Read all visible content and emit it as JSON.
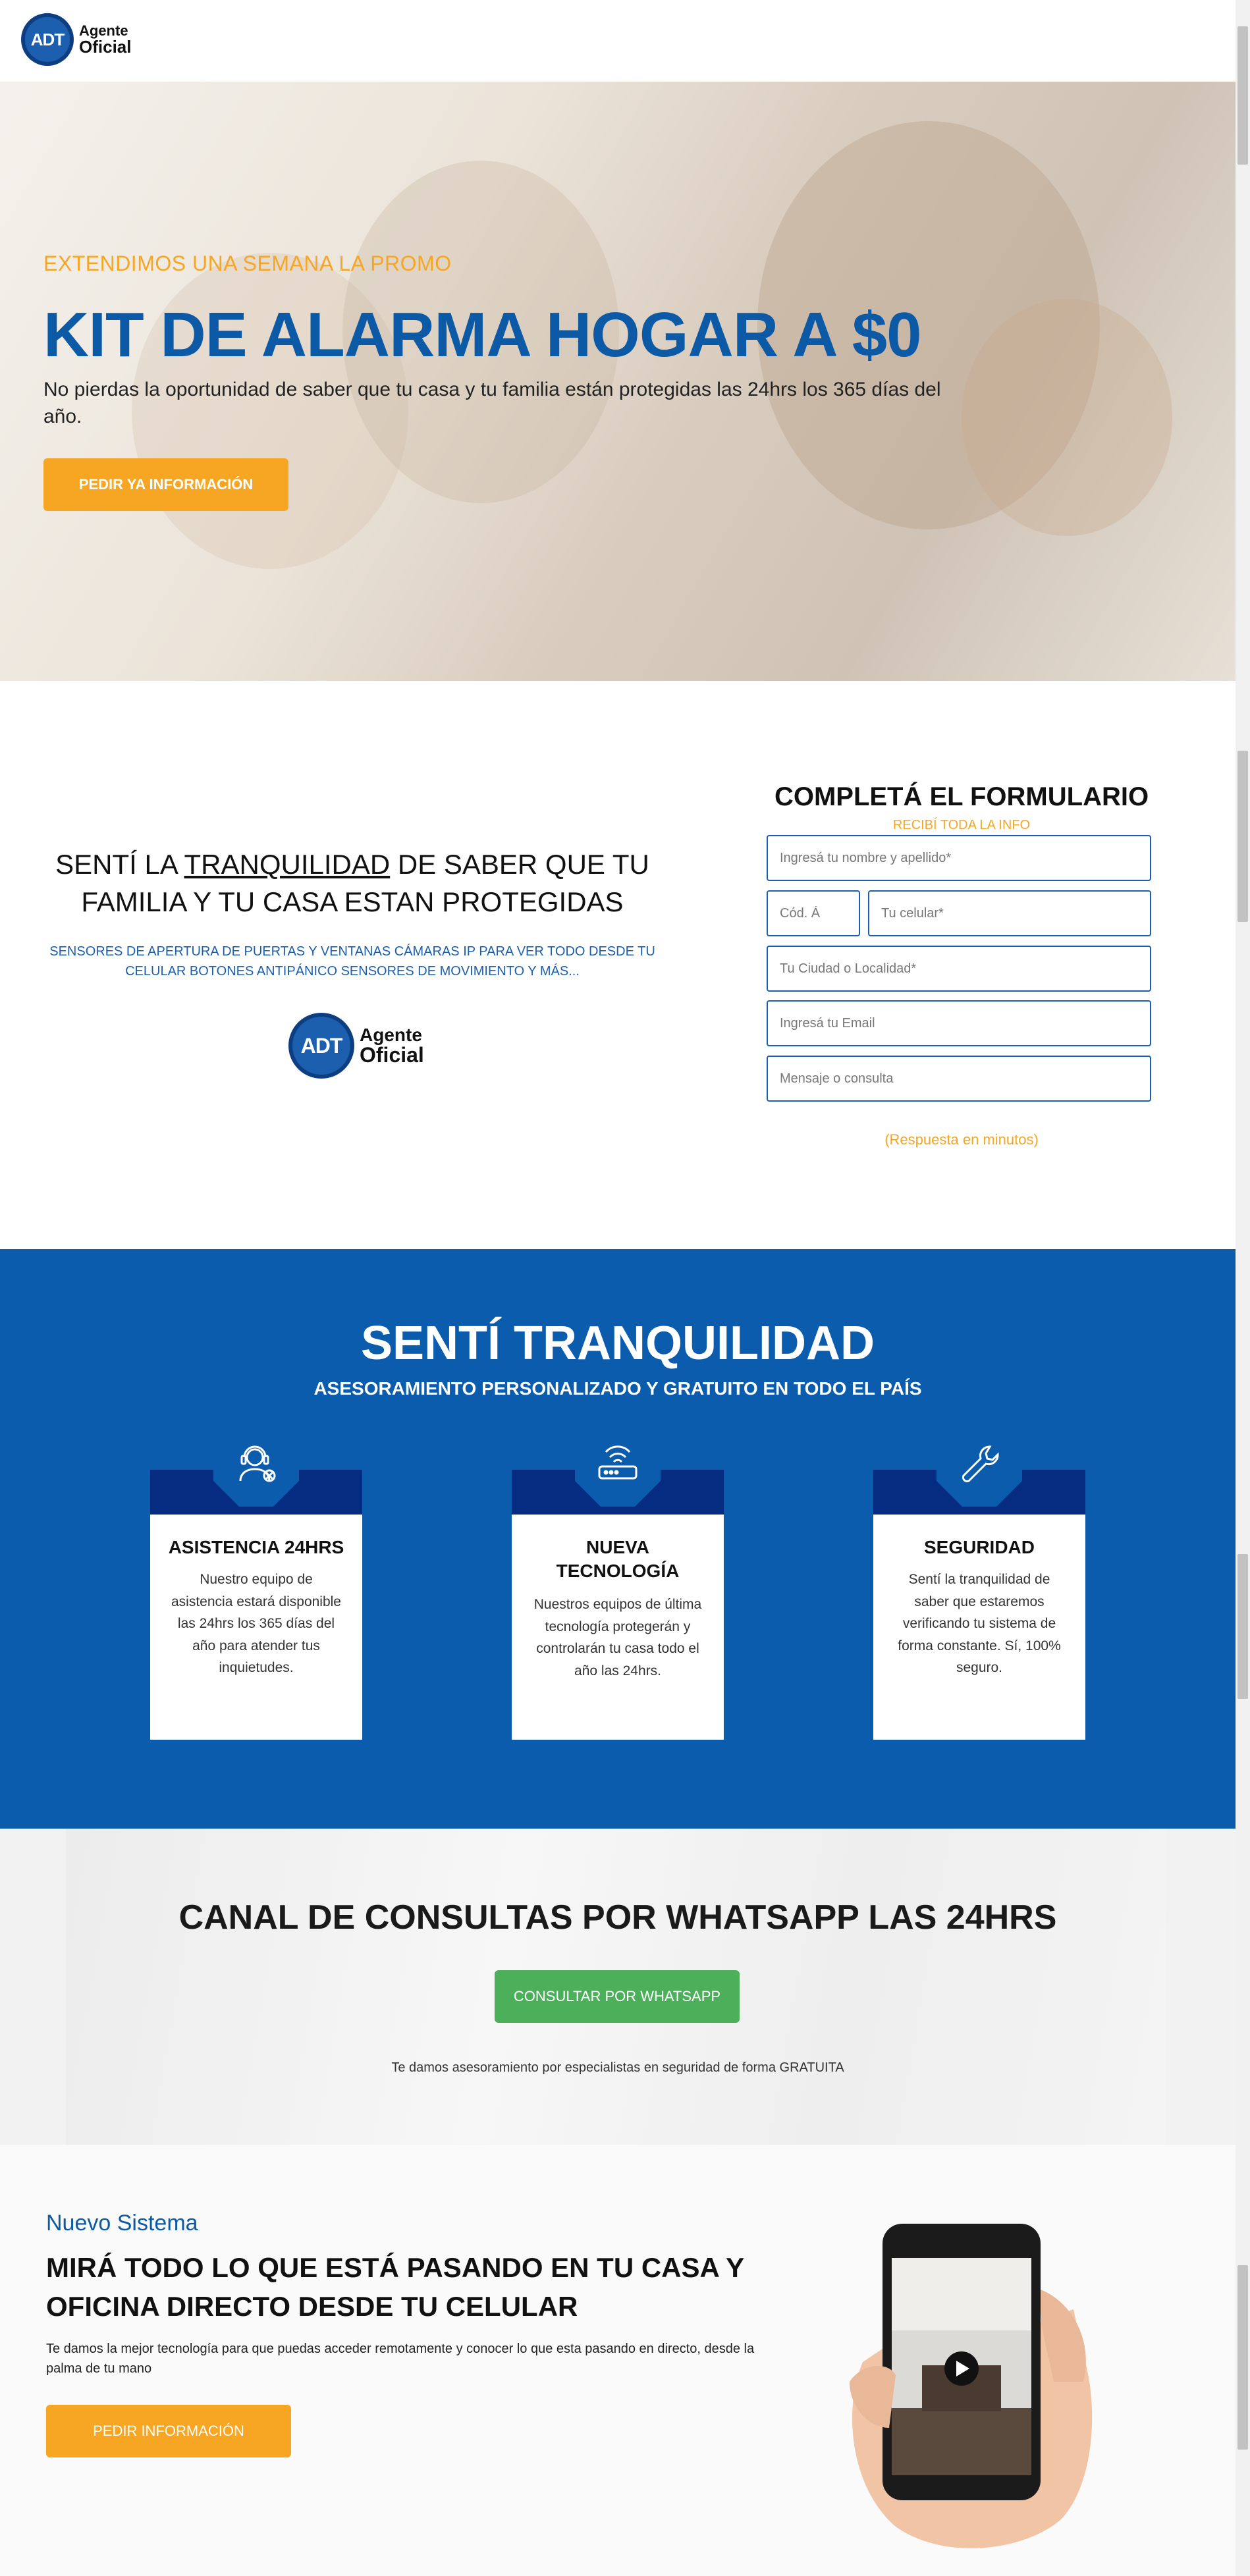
{
  "header": {
    "logo_mark": "ADT",
    "logo_line1": "Agente",
    "logo_line2": "Oficial"
  },
  "hero": {
    "promo": "EXTENDIMOS UNA SEMANA LA PROMO",
    "title": "KIT DE ALARMA HOGAR A $0",
    "subtitle": "No pierdas la oportunidad de saber que tu casa y tu familia están protegidas las 24hrs los 365 días del año.",
    "button": "PEDIR YA INFORMACIÓN"
  },
  "info": {
    "title_pre": "SENTÍ LA ",
    "title_underlined": "TRANQUILIDAD",
    "title_post": " DE SABER QUE TU FAMILIA Y TU CASA ESTAN PROTEGIDAS",
    "sensors": "SENSORES DE APERTURA DE PUERTAS Y VENTANAS CÁMARAS IP PARA VER TODO DESDE TU CELULAR BOTONES ANTIPÁNICO SENSORES DE MOVIMIENTO Y MÁS..."
  },
  "form": {
    "title": "COMPLETÁ EL FORMULARIO",
    "subtitle": "RECIBÍ TODA LA INFO",
    "name_placeholder": "Ingresá tu nombre y apellido*",
    "area_placeholder": "Cód. Á",
    "phone_placeholder": "Tu celular*",
    "city_placeholder": "Tu Ciudad o Localidad*",
    "email_placeholder": "Ingresá tu Email",
    "message_placeholder": "Mensaje o consulta",
    "note": "(Respuesta en minutos)"
  },
  "band": {
    "title": "SENTÍ TRANQUILIDAD",
    "subtitle": "ASESORAMIENTO PERSONALIZADO Y GRATUITO EN TODO EL PAÍS",
    "cards": [
      {
        "icon": "support-agent-icon",
        "title": "ASISTENCIA 24HRS",
        "text": "Nuestro equipo de asistencia estará disponible las 24hrs los 365 días del año para atender tus inquietudes."
      },
      {
        "icon": "router-icon",
        "title": "NUEVA TECNOLOGÍA",
        "text": "Nuestros equipos de última tecnología protegerán y controlarán tu casa todo el año las 24hrs."
      },
      {
        "icon": "wrench-icon",
        "title": "SEGURIDAD",
        "text": "Sentí la tranquilidad de saber que estaremos verificando tu sistema de forma constante. Sí, 100% seguro."
      }
    ]
  },
  "whatsapp": {
    "title": "CANAL DE CONSULTAS POR WHATSAPP LAS 24HRS",
    "button": "CONSULTAR POR WHATSAPP",
    "note": "Te damos asesoramiento por especialistas en seguridad de forma GRATUITA"
  },
  "new_system": {
    "kicker": "Nuevo Sistema",
    "title": "MIRÁ TODO LO QUE ESTÁ PASANDO EN TU CASA Y OFICINA DIRECTO DESDE TU CELULAR",
    "text": "Te damos la mejor tecnología para que puedas acceder remotamente y conocer lo que esta pasando en directo, desde la palma de tu mano",
    "button": "PEDIR INFORMACIÓN"
  },
  "colors": {
    "brand_blue": "#0b5cad",
    "accent_orange": "#f6a623",
    "whatsapp_green": "#4cb05b",
    "dark_navy": "#052c80"
  }
}
